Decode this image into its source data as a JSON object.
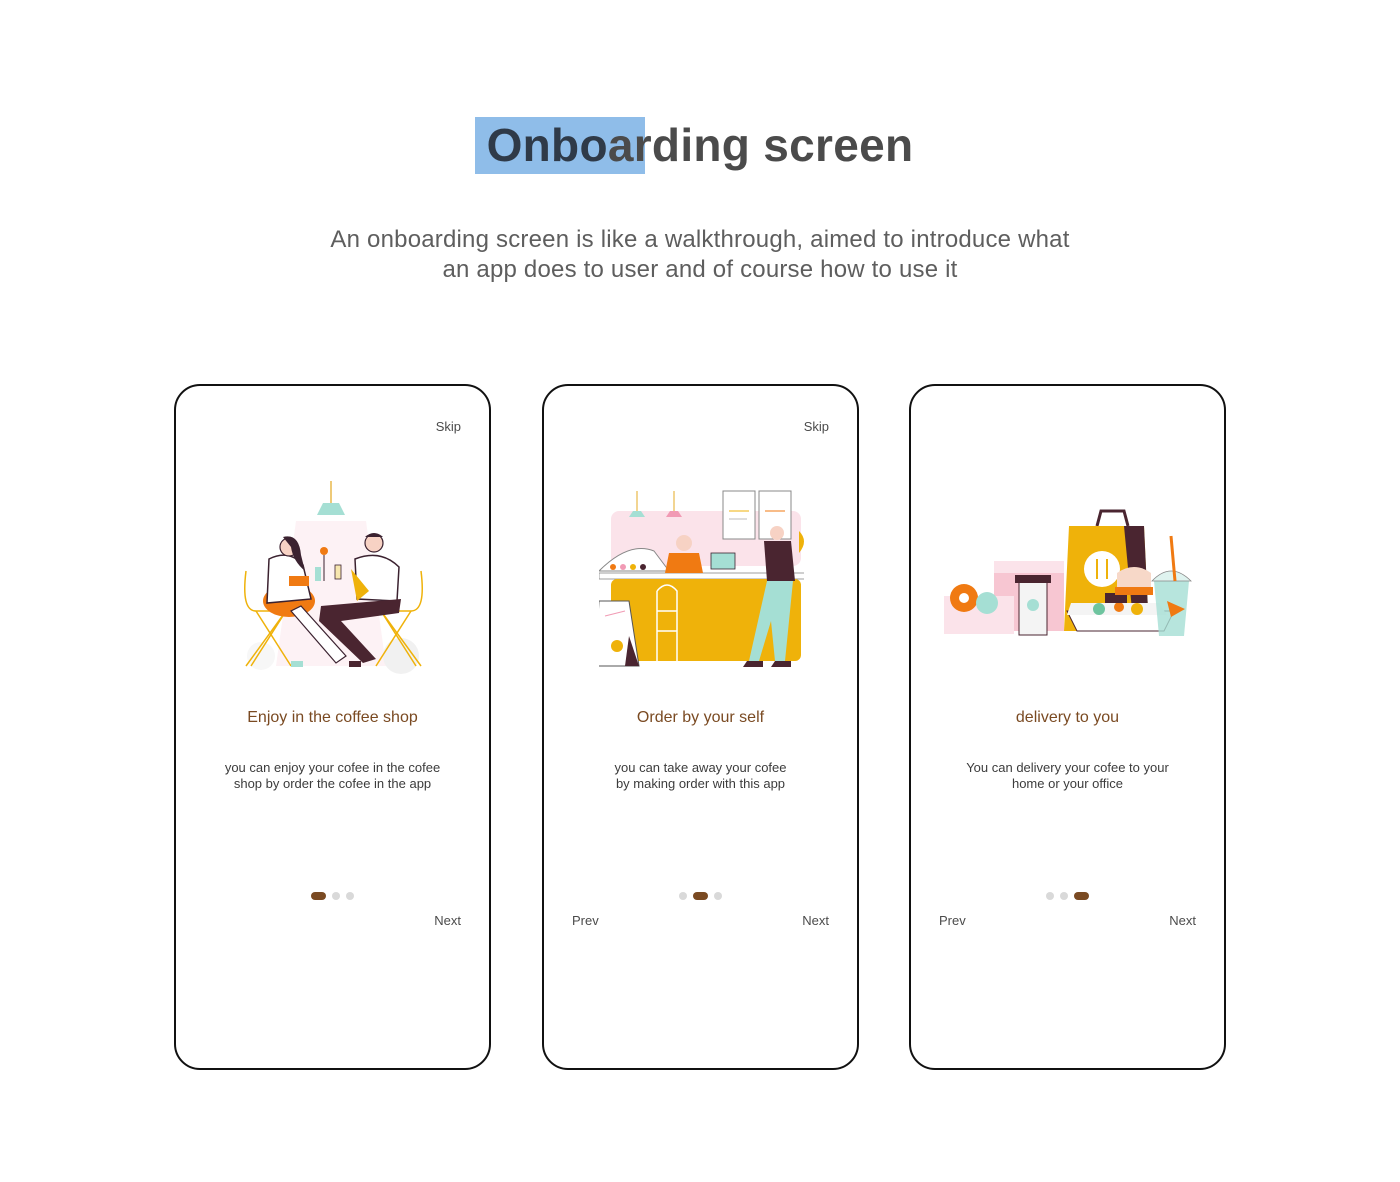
{
  "header": {
    "title_part1": "Onbo",
    "title_part2": "arding screen",
    "subtitle_line1": "An onboarding screen is like a walkthrough, aimed to introduce what",
    "subtitle_line2": "an app does to user and of course how to use it"
  },
  "colors": {
    "accent_brown": "#7a4a22",
    "yellow": "#efb20a",
    "orange": "#f07a12",
    "highlight": "#8fbde9",
    "teal": "#a5dfd4",
    "pink": "#f7c6d2"
  },
  "screens": [
    {
      "skip_label": "Skip",
      "illustration": "couple-at-cafe-table",
      "title": "Enjoy in the coffee shop",
      "desc_line1": "you can enjoy your cofee in the cofee",
      "desc_line2": "shop by order the cofee in the app",
      "prev_label": "",
      "next_label": "Next",
      "active_dot": 0
    },
    {
      "skip_label": "Skip",
      "illustration": "cafe-counter-order",
      "title": "Order by your self",
      "desc_line1": "you can take away your cofee",
      "desc_line2": "by making order with this app",
      "prev_label": "Prev",
      "next_label": "Next",
      "active_dot": 1
    },
    {
      "skip_label": "",
      "illustration": "food-delivery-bags",
      "title": "delivery to you",
      "desc_line1": "You can delivery your cofee to your",
      "desc_line2": "home or your office",
      "prev_label": "Prev",
      "next_label": "Next",
      "active_dot": 2
    }
  ]
}
